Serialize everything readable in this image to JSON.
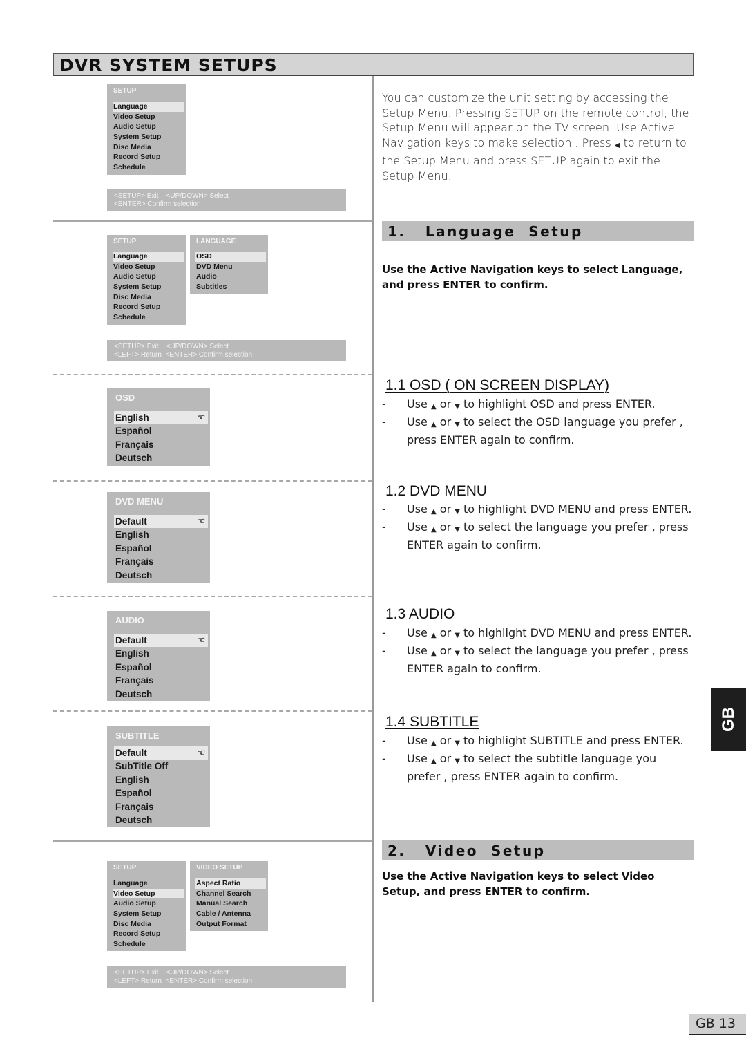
{
  "page_title": "DVR SYSTEM SETUPS",
  "left_panels": {
    "setup_menu_1": {
      "header": "SETUP",
      "items": [
        "Language",
        "Video Setup",
        "Audio Setup",
        "System Setup",
        "Disc Media",
        "Record Setup",
        "Schedule"
      ],
      "selected_index": 0
    },
    "hint_1": {
      "line1": "<SETUP> Exit    <UP/DOWN> Select",
      "line2": "<ENTER> Confirm selection"
    },
    "setup_menu_2": {
      "header": "SETUP",
      "items": [
        "Language",
        "Video Setup",
        "Audio Setup",
        "System Setup",
        "Disc Media",
        "Record Setup",
        "Schedule"
      ],
      "selected_index": 0
    },
    "language_menu": {
      "header": "LANGUAGE",
      "items": [
        "OSD",
        "DVD Menu",
        "Audio",
        "Subtitles"
      ],
      "selected_index": 0
    },
    "hint_2": {
      "line1": "<SETUP> Exit    <UP/DOWN> Select",
      "line2": "<LEFT> Return  <ENTER> Confirm selection"
    },
    "osd_menu": {
      "header": "OSD",
      "items": [
        "English",
        "Español",
        "Français",
        "Deutsch"
      ],
      "selected_index": 0
    },
    "dvd_menu": {
      "header": "DVD MENU",
      "items": [
        "Default",
        "English",
        "Español",
        "Français",
        "Deutsch"
      ],
      "selected_index": 0
    },
    "audio_menu": {
      "header": "AUDIO",
      "items": [
        "Default",
        "English",
        "Español",
        "Français",
        "Deutsch"
      ],
      "selected_index": 0
    },
    "subtitle_menu": {
      "header": "SUBTITLE",
      "items": [
        "Default",
        "SubTitle Off",
        "English",
        "Español",
        "Français",
        "Deutsch"
      ],
      "selected_index": 0
    },
    "setup_menu_3": {
      "header": "SETUP",
      "items": [
        "Language",
        "Video Setup",
        "Audio Setup",
        "System Setup",
        "Disc Media",
        "Record Setup",
        "Schedule"
      ],
      "selected_index": 1
    },
    "video_setup_menu": {
      "header": "VIDEO SETUP",
      "items": [
        "Aspect Ratio",
        "Channel Search",
        "Manual Search",
        "Cable / Antenna",
        "Output Format"
      ],
      "selected_index": 0
    },
    "hint_3": {
      "line1": "<SETUP> Exit    <UP/DOWN> Select",
      "line2": "<LEFT> Return  <ENTER> Confirm selection"
    }
  },
  "intro": {
    "text_before_icon": "You can customize the unit setting by accessing the Setup Menu.  Pressing SETUP on the remote control, the Setup Menu will appear on the TV screen.  Use Active Navigation keys to make selection . Press",
    "icon": "left-arrow",
    "text_after_icon": "to return to the Setup Menu and press SETUP again to exit the Setup Menu."
  },
  "section1": {
    "title": "1.   Language  Setup",
    "instruction": "Use the Active Navigation keys to select Language, and press ENTER to confirm."
  },
  "subsections": [
    {
      "heading": "1.1  OSD ( ON SCREEN DISPLAY)",
      "bullets": [
        {
          "pre": "Use",
          "mid": "or",
          "post": "to highlight OSD and press ENTER."
        },
        {
          "pre": "Use",
          "mid": "or",
          "post": "to select the OSD language you prefer , press ENTER again to confirm."
        }
      ]
    },
    {
      "heading": "1.2  DVD MENU",
      "bullets": [
        {
          "pre": "Use",
          "mid": "or",
          "post": "to highlight DVD MENU and press ENTER."
        },
        {
          "pre": "Use",
          "mid": "or",
          "post": "to select the language you prefer , press ENTER again to confirm."
        }
      ]
    },
    {
      "heading": "1.3  AUDIO",
      "bullets": [
        {
          "pre": "Use",
          "mid": "or",
          "post": "to highlight DVD MENU and press ENTER."
        },
        {
          "pre": "Use",
          "mid": "or",
          "post": "to select the language you prefer , press ENTER again to confirm."
        }
      ]
    },
    {
      "heading": "1.4  SUBTITLE",
      "bullets": [
        {
          "pre": "Use",
          "mid": "or",
          "post": "to highlight SUBTITLE and press ENTER."
        },
        {
          "pre": "Use",
          "mid": "or",
          "post": "to select the subtitle language you prefer , press ENTER again to confirm."
        }
      ]
    }
  ],
  "section2": {
    "title": "2.   Video  Setup",
    "instruction": "Use the Active Navigation keys to select Video Setup, and press ENTER to confirm."
  },
  "side_tab": "GB",
  "page_number": "GB 13",
  "glyphs": {
    "up": "▲",
    "down": "▼",
    "left": "◀",
    "dash": "-",
    "hand": "☜"
  }
}
